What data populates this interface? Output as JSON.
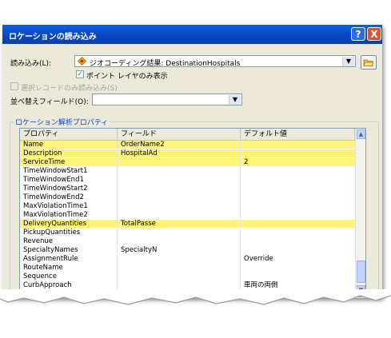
{
  "window": {
    "title": "ロケーションの読み込み",
    "help_label": "?",
    "close_label": "X"
  },
  "load_from": {
    "label": "読み込み(L):",
    "value": "ジオコーディング結果: DestinationHospitals",
    "point_layer_checkbox": {
      "label": "ポイント レイヤのみ表示",
      "checked": true
    }
  },
  "selected_only": {
    "label": "選択レコードのみ読み込み(S)",
    "checked": false,
    "disabled": true
  },
  "sort_field": {
    "label": "並べ替えフィールド(O):",
    "value": ""
  },
  "properties_group": {
    "title": "ロケーション解析プロパティ",
    "columns": [
      "プロパティ",
      "フィールド",
      "デフォルト値"
    ],
    "rows": [
      {
        "property": "Name",
        "field": "OrderName2",
        "default": "",
        "highlight": true
      },
      {
        "property": "Description",
        "field": "HospitalAd",
        "default": "",
        "highlight": true
      },
      {
        "property": "ServiceTime",
        "field": "",
        "default": "2",
        "highlight": true
      },
      {
        "property": "TimeWindowStart1",
        "field": "",
        "default": "",
        "highlight": false
      },
      {
        "property": "TimeWindowEnd1",
        "field": "",
        "default": "",
        "highlight": false
      },
      {
        "property": "TimeWindowStart2",
        "field": "",
        "default": "",
        "highlight": false
      },
      {
        "property": "TimeWindowEnd2",
        "field": "",
        "default": "",
        "highlight": false
      },
      {
        "property": "MaxViolationTime1",
        "field": "",
        "default": "",
        "highlight": false
      },
      {
        "property": "MaxViolationTime2",
        "field": "",
        "default": "",
        "highlight": false
      },
      {
        "property": "DeliveryQuantities",
        "field": "TotalPasse",
        "default": "",
        "highlight": true
      },
      {
        "property": "PickupQuantities",
        "field": "",
        "default": "",
        "highlight": false
      },
      {
        "property": "Revenue",
        "field": "",
        "default": "",
        "highlight": false
      },
      {
        "property": "SpecialtyNames",
        "field": "SpecialtyN",
        "default": "",
        "highlight": false
      },
      {
        "property": "AssignmentRule",
        "field": "",
        "default": "Override",
        "highlight": false
      },
      {
        "property": "RouteName",
        "field": "",
        "default": "",
        "highlight": false
      },
      {
        "property": "Sequence",
        "field": "",
        "default": "",
        "highlight": false
      },
      {
        "property": "CurbApproach",
        "field": "",
        "default": "車両の両側",
        "highlight": false
      }
    ]
  },
  "colors": {
    "highlight": "#fff37a",
    "title_bar": "#0a5fe0",
    "group_title": "#0046d5"
  },
  "icons": [
    "help-icon",
    "close-icon",
    "geocode-layer-icon",
    "dropdown-arrow-icon",
    "folder-open-icon",
    "scroll-up-icon",
    "scroll-down-icon"
  ]
}
